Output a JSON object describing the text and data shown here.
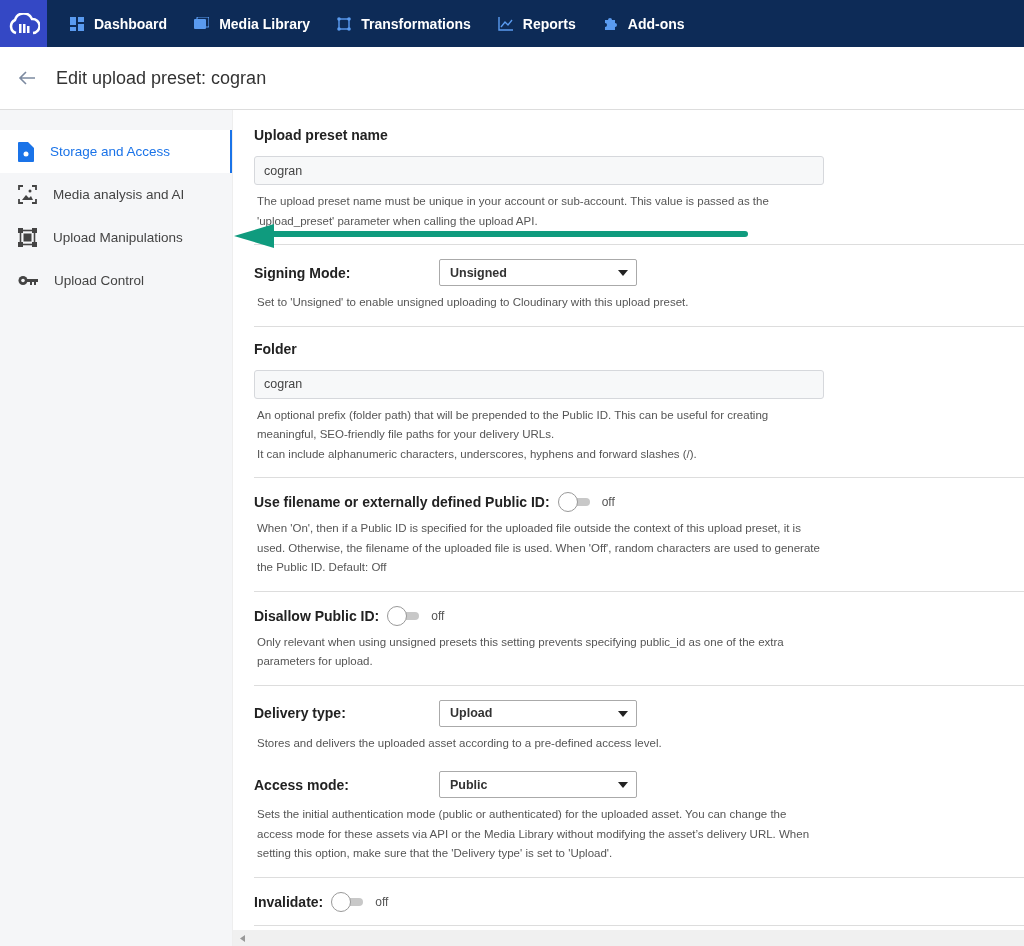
{
  "nav": {
    "items": [
      {
        "label": "Dashboard"
      },
      {
        "label": "Media Library"
      },
      {
        "label": "Transformations"
      },
      {
        "label": "Reports"
      },
      {
        "label": "Add-ons"
      }
    ]
  },
  "header": {
    "title": "Edit upload preset: cogran"
  },
  "sidebar": {
    "items": [
      {
        "label": "Storage and Access",
        "selected": true
      },
      {
        "label": "Media analysis and AI",
        "selected": false
      },
      {
        "label": "Upload Manipulations",
        "selected": false
      },
      {
        "label": "Upload Control",
        "selected": false
      }
    ]
  },
  "sections": [
    {
      "fields": [
        {
          "kind": "text",
          "label": "Upload preset name",
          "value": "cogran",
          "description": [
            "The upload preset name must be unique in your account or sub-account. This value is passed as the",
            "'upload_preset' parameter when calling the upload API."
          ]
        }
      ]
    },
    {
      "fields": [
        {
          "kind": "select",
          "label": "Signing Mode:",
          "value": "Unsigned",
          "description": [
            "Set to 'Unsigned' to enable unsigned uploading to Cloudinary with this upload preset."
          ]
        }
      ]
    },
    {
      "fields": [
        {
          "kind": "text",
          "label": "Folder",
          "value": "cogran",
          "description": [
            "An optional prefix (folder path) that will be prepended to the Public ID. This can be useful for creating",
            "meaningful, SEO-friendly file paths for your delivery URLs.",
            "It can include alphanumeric characters, underscores, hyphens and forward slashes (/)."
          ]
        }
      ]
    },
    {
      "fields": [
        {
          "kind": "toggle",
          "label": "Use filename or externally defined Public ID:",
          "on": false,
          "state_label": "off",
          "description": [
            "When 'On', then if a Public ID is specified for the uploaded file outside the context of this upload preset, it is",
            "used. Otherwise, the filename of the uploaded file is used. When 'Off', random characters are used to generate",
            "the Public ID. Default: Off"
          ]
        }
      ]
    },
    {
      "fields": [
        {
          "kind": "toggle",
          "label": "Disallow Public ID:",
          "on": false,
          "state_label": "off",
          "description": [
            "Only relevant when using unsigned presets this setting prevents specifying public_id as one of the extra",
            "parameters for upload."
          ]
        }
      ]
    },
    {
      "fields": [
        {
          "kind": "select",
          "label": "Delivery type:",
          "value": "Upload",
          "description": [
            "Stores and delivers the uploaded asset according to a pre-defined access level."
          ]
        },
        {
          "kind": "select",
          "label": "Access mode:",
          "value": "Public",
          "description": [
            "Sets the initial authentication mode (public or authenticated) for the uploaded asset. You can change the",
            "access mode for these assets via API or the Media Library without modifying the asset’s delivery URL. When",
            "setting this option, make sure that the 'Delivery type' is set to 'Upload'."
          ]
        }
      ]
    },
    {
      "fields": [
        {
          "kind": "toggle",
          "label": "Invalidate:",
          "on": false,
          "state_label": "off"
        }
      ]
    }
  ]
}
